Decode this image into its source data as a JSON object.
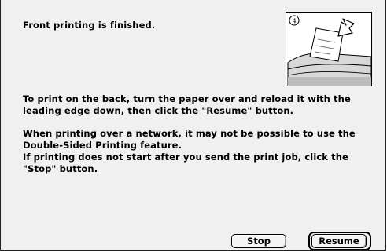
{
  "dialog": {
    "headline": "Front printing is finished.",
    "paragraph1": [
      "To print on the back, turn the paper over and reload it with the",
      "leading edge down, then click the \"Resume\" button."
    ],
    "paragraph2": [
      "When printing over a network, it may not be possible to use the",
      "Double-Sided Printing feature.",
      "If printing does not start after you send the print job, click the",
      "\"Stop\" button."
    ],
    "illustration": {
      "step_number": "4",
      "icon": "printer-reload-paper-icon"
    },
    "buttons": {
      "stop": "Stop",
      "resume": "Resume"
    }
  },
  "colors": {
    "background": "#f0f0f0",
    "border": "#222222",
    "text": "#000000"
  }
}
